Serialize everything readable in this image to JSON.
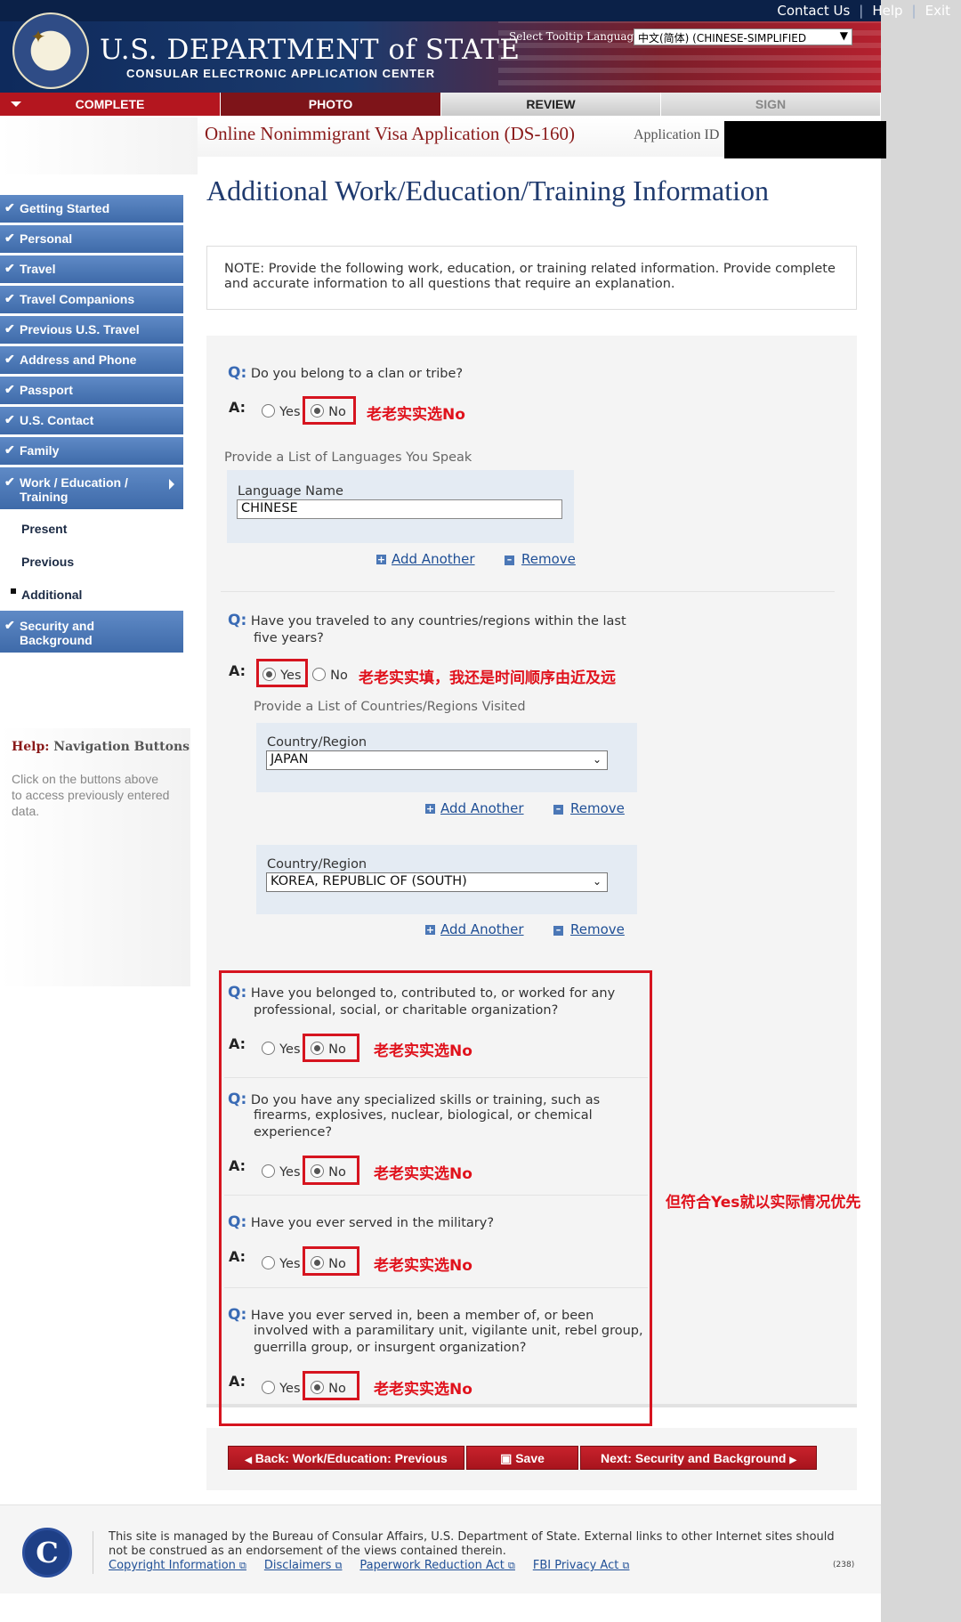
{
  "header": {
    "top_links": [
      "Contact Us",
      "Help",
      "Exit"
    ],
    "dept_title": "U.S. DEPARTMENT of STATE",
    "dept_subtitle": "CONSULAR ELECTRONIC APPLICATION CENTER",
    "tooltip_label": "Select Tooltip Language",
    "tooltip_language": "中文(简体)  (CHINESE-SIMPLIFIED"
  },
  "tabs": [
    "COMPLETE",
    "PHOTO",
    "REVIEW",
    "SIGN"
  ],
  "app": {
    "title": "Online Nonimmigrant Visa Application (DS-160)",
    "id_label": "Application ID"
  },
  "page_heading": "Additional Work/Education/Training Information",
  "sidebar": {
    "items": [
      "Getting Started",
      "Personal",
      "Travel",
      "Travel Companions",
      "Previous U.S. Travel",
      "Address and Phone",
      "Passport",
      "U.S. Contact",
      "Family"
    ],
    "work_item_line1": "Work / Education /",
    "work_item_line2": "Training",
    "sub_items": [
      "Present",
      "Previous",
      "Additional"
    ],
    "security_line1": "Security and",
    "security_line2": "Background",
    "help_title_red": "Help:",
    "help_title_rest": "Navigation Buttons",
    "help_text": "Click on the buttons above to access previously entered data."
  },
  "note": "NOTE: Provide the following work, education, or training related information. Provide complete and accurate information to all questions that require an explanation.",
  "labels": {
    "q": "Q:",
    "a": "A:",
    "yes": "Yes",
    "no": "No"
  },
  "questions": {
    "clan": "Do you belong to a clan or tribe?",
    "traveled_line1": "Have you traveled to any countries/regions within the last",
    "traveled_line2": "five years?",
    "organization_line1": "Have you belonged to, contributed to, or worked for any",
    "organization_line2": "professional, social, or charitable organization?",
    "skills_line1": "Do you have any specialized skills or training, such as",
    "skills_line2": "firearms, explosives, nuclear, biological, or chemical",
    "skills_line3": "experience?",
    "military": "Have you ever served in the military?",
    "paramilitary_line1": "Have you ever served in, been a member of, or been",
    "paramilitary_line2": "involved with a paramilitary unit, vigilante unit, rebel group,",
    "paramilitary_line3": "guerrilla group, or insurgent organization?"
  },
  "languages": {
    "section_label": "Provide a List of Languages You Speak",
    "field_label": "Language Name",
    "value": "CHINESE"
  },
  "countries": {
    "section_label": "Provide a List of Countries/Regions Visited",
    "field_label": "Country/Region",
    "values": [
      "JAPAN",
      "KOREA, REPUBLIC OF (SOUTH)"
    ]
  },
  "links": {
    "add_another": "Add Another",
    "remove": "Remove"
  },
  "annotations": {
    "choose_no": "老老实实选No",
    "travel_note": "老老实实填，我还是时间顺序由近及远",
    "yes_priority": "但符合Yes就以实际情况优先"
  },
  "buttons": {
    "back": "Back: Work/Education: Previous",
    "save": "Save",
    "next": "Next: Security and Background"
  },
  "footer": {
    "text": "This site is managed by the Bureau of Consular Affairs, U.S. Department of State. External links to other Internet sites should not be construed as an endorsement of the views contained therein.",
    "links": [
      "Copyright Information",
      "Disclaimers",
      "Paperwork Reduction Act",
      "FBI Privacy Act"
    ],
    "code": "(238)"
  },
  "colors": {
    "annotation_red": "#e0121c",
    "nav_blue": "#3e6aa9",
    "tab_red": "#b4161f"
  }
}
